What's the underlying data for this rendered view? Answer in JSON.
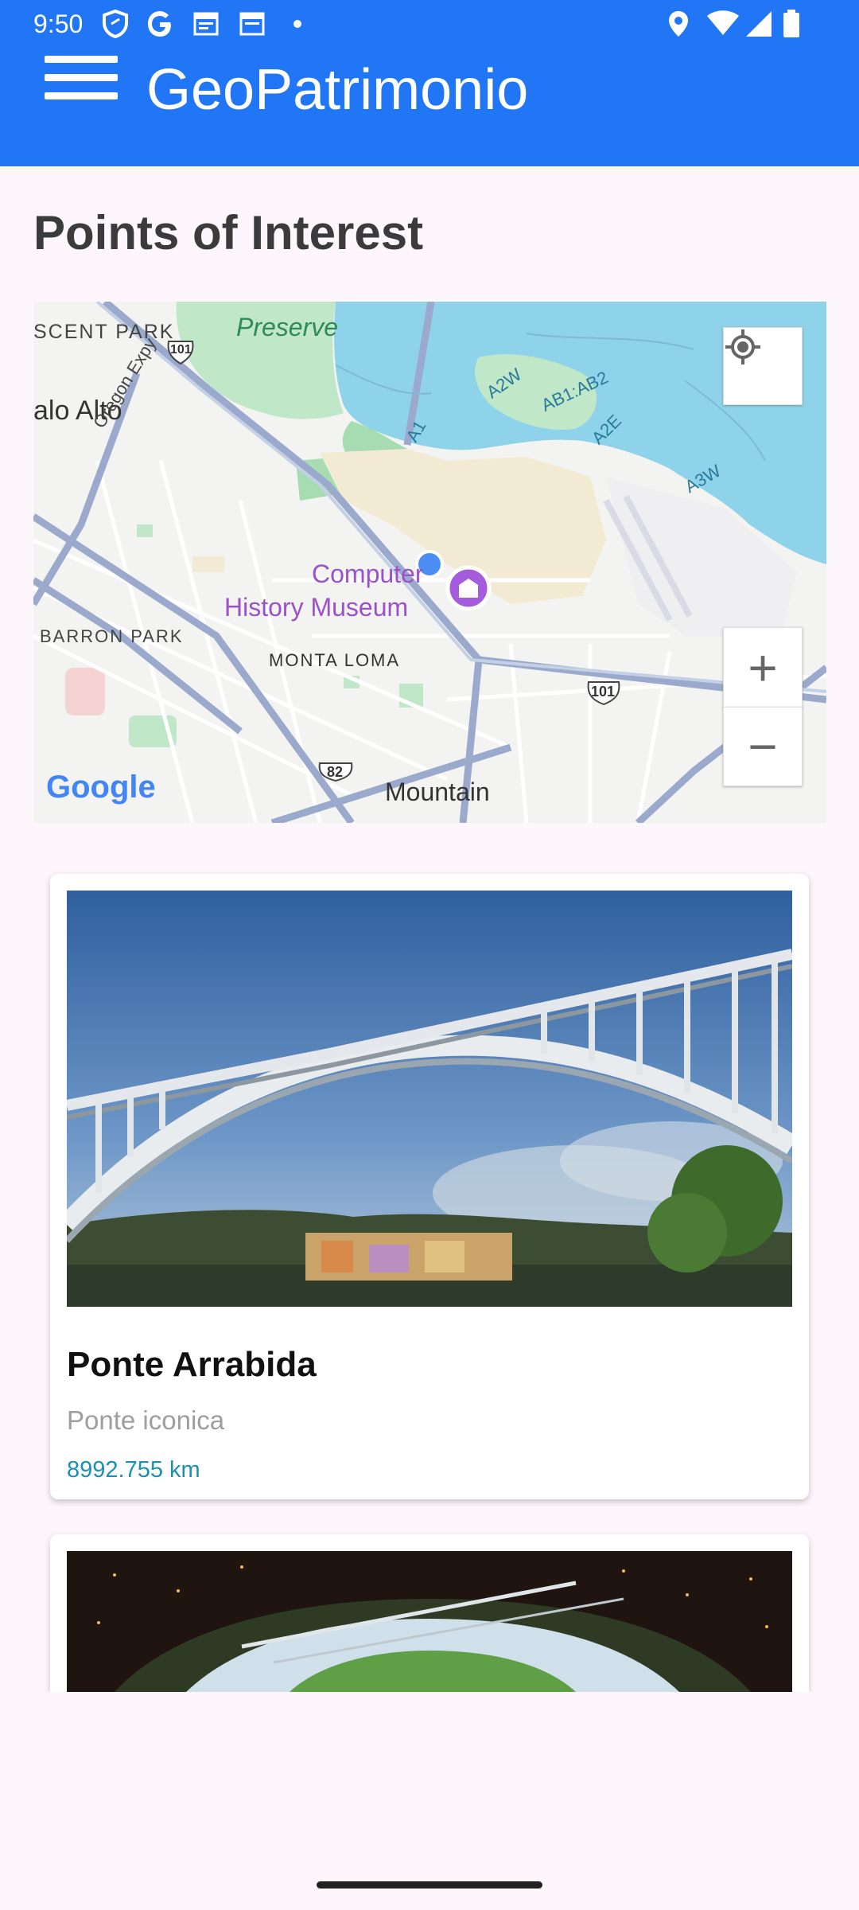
{
  "status_bar": {
    "time": "9:50"
  },
  "app_bar": {
    "title": "GeoPatrimonio",
    "menu_icon": "hamburger-menu-icon"
  },
  "page": {
    "title": "Points of Interest"
  },
  "map": {
    "labels": {
      "preserve": "Preserve",
      "crescent_park": "SCENT PARK",
      "palo_alto": "alo Alto",
      "oregon_expy": "Oregon Expy",
      "a1": "A1",
      "a2w": "A2W",
      "ab1ab2": "AB1:AB2",
      "a2e": "A2E",
      "a3w": "A3W",
      "museum_line1": "Computer",
      "museum_line2": "History Museum",
      "barron_park": "BARRON PARK",
      "monta_loma": "MONTA LOMA",
      "mountain_view": "Mountain",
      "route_101_a": "101",
      "route_101_b": "101",
      "route_82": "82",
      "google": "Google"
    },
    "controls": {
      "locate": "my-location-icon",
      "zoom_in": "+",
      "zoom_out": "−"
    }
  },
  "pois": [
    {
      "title": "Ponte Arrabida",
      "description": "Ponte iconica",
      "distance": "8992.755 km"
    },
    {
      "title": "",
      "description": "",
      "distance": ""
    }
  ]
}
